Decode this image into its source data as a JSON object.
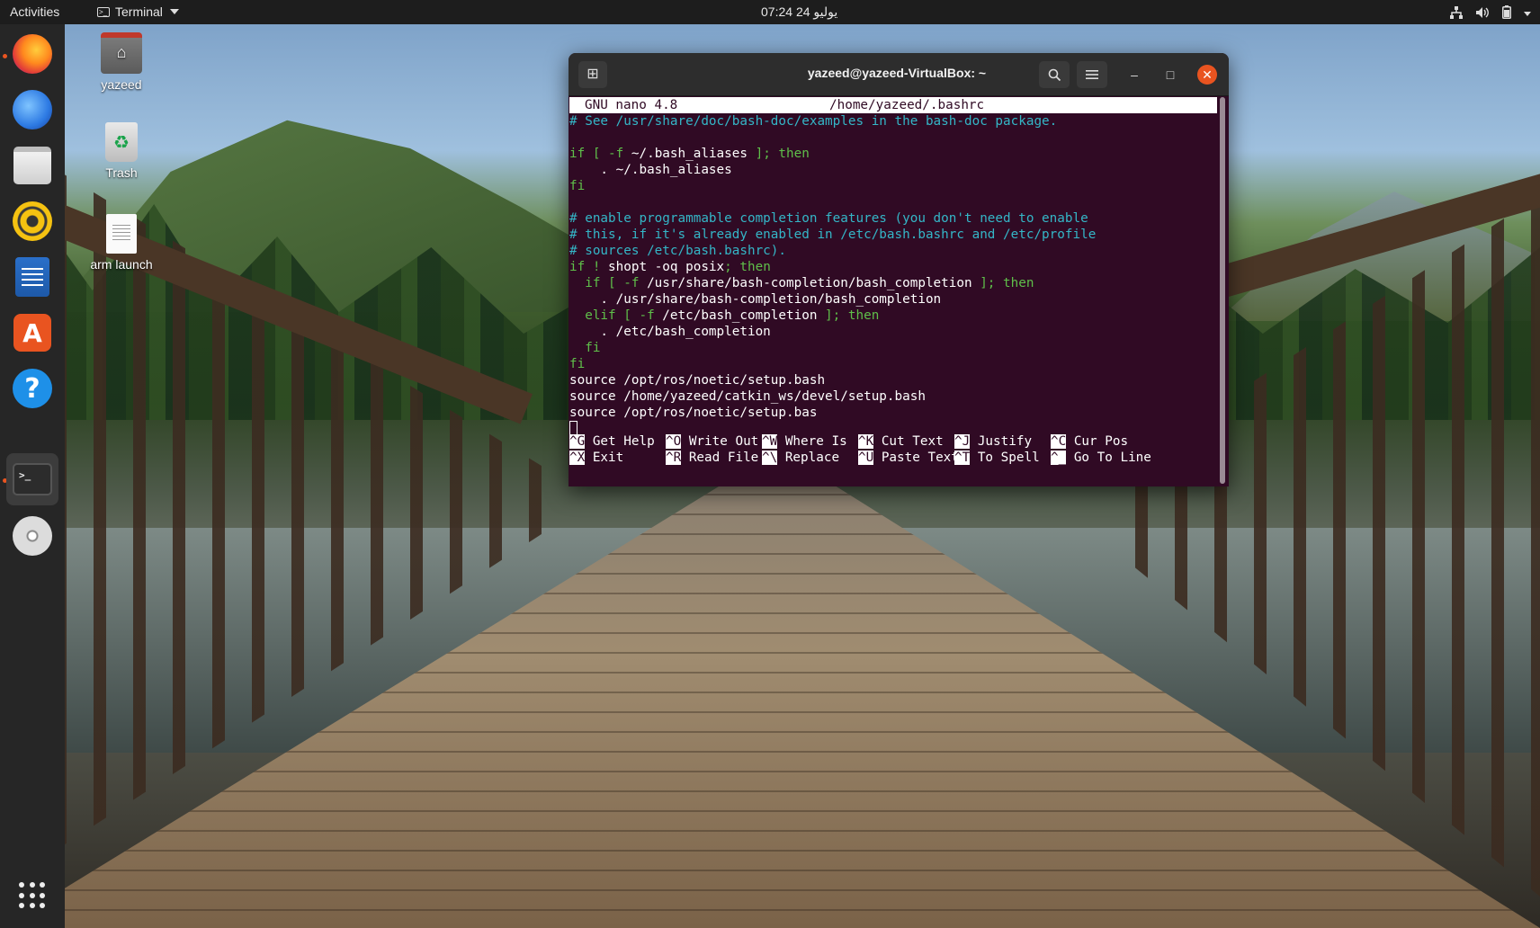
{
  "topbar": {
    "activities": "Activities",
    "app_menu_label": "Terminal",
    "clock": "يوليو 24  07:24",
    "icons": [
      "network-icon",
      "volume-icon",
      "battery-icon",
      "system-menu-caret"
    ]
  },
  "dock": {
    "items": [
      {
        "name": "firefox",
        "icon": "firefox-icon"
      },
      {
        "name": "thunderbird",
        "icon": "thunderbird-icon"
      },
      {
        "name": "files",
        "icon": "files-icon"
      },
      {
        "name": "rhythmbox",
        "icon": "rhythmbox-icon"
      },
      {
        "name": "libreoffice-writer",
        "icon": "writer-icon"
      },
      {
        "name": "ubuntu-software",
        "icon": "software-store-icon"
      },
      {
        "name": "help",
        "icon": "help-icon"
      },
      {
        "name": "terminal",
        "icon": "terminal-icon",
        "active": true
      },
      {
        "name": "dvd",
        "icon": "dvd-icon"
      },
      {
        "name": "show-applications",
        "icon": "app-grid-icon"
      }
    ],
    "terminal_glyph": ">_",
    "help_glyph": "?",
    "store_glyph": "A"
  },
  "desktop": {
    "icons": [
      {
        "label": "yazeed",
        "icon": "home-folder-icon"
      },
      {
        "label": "Trash",
        "icon": "trash-icon"
      },
      {
        "label": "arm launch",
        "icon": "text-file-icon"
      }
    ]
  },
  "terminal": {
    "title": "yazeed@yazeed-VirtualBox: ~",
    "new_tab_glyph": "⊞",
    "search_glyph": "⌕",
    "menu_glyph": "☰",
    "minimize_glyph": "–",
    "maximize_glyph": "□",
    "close_glyph": "✕",
    "nano": {
      "version": "GNU nano 4.8",
      "file": "/home/yazeed/.bashrc",
      "lines": [
        [
          {
            "t": "# See /usr/share/doc/bash-doc/examples in the bash-doc package.",
            "c": "comment"
          }
        ],
        [],
        [
          {
            "t": "if",
            "c": "kw"
          },
          {
            "t": " [ -f ",
            "c": "kw"
          },
          {
            "t": "~/.bash_aliases",
            "c": "plain"
          },
          {
            "t": " ]; then",
            "c": "kw"
          }
        ],
        [
          {
            "t": "    . ~/.bash_aliases",
            "c": "plain"
          }
        ],
        [
          {
            "t": "fi",
            "c": "kw"
          }
        ],
        [],
        [
          {
            "t": "# enable programmable completion features (you don't need to enable",
            "c": "comment"
          }
        ],
        [
          {
            "t": "# this, if it's already enabled in /etc/bash.bashrc and /etc/profile",
            "c": "comment"
          }
        ],
        [
          {
            "t": "# sources /etc/bash.bashrc).",
            "c": "comment"
          }
        ],
        [
          {
            "t": "if ! ",
            "c": "kw"
          },
          {
            "t": "shopt -oq posix",
            "c": "plain"
          },
          {
            "t": "; then",
            "c": "kw"
          }
        ],
        [
          {
            "t": "  if [ -f ",
            "c": "kw"
          },
          {
            "t": "/usr/share/bash-completion/bash_completion",
            "c": "plain"
          },
          {
            "t": " ]; then",
            "c": "kw"
          }
        ],
        [
          {
            "t": "    . /usr/share/bash-completion/bash_completion",
            "c": "plain"
          }
        ],
        [
          {
            "t": "  elif [ -f ",
            "c": "kw"
          },
          {
            "t": "/etc/bash_completion",
            "c": "plain"
          },
          {
            "t": " ]; then",
            "c": "kw"
          }
        ],
        [
          {
            "t": "    . /etc/bash_completion",
            "c": "plain"
          }
        ],
        [
          {
            "t": "  fi",
            "c": "kw"
          }
        ],
        [
          {
            "t": "fi",
            "c": "kw"
          }
        ],
        [
          {
            "t": "source /opt/ros/noetic/setup.bash",
            "c": "plain"
          }
        ],
        [
          {
            "t": "source /home/yazeed/catkin_ws/devel/setup.bash",
            "c": "plain"
          }
        ],
        [
          {
            "t": "source /opt/ros/noetic/setup.bas",
            "c": "plain"
          }
        ],
        [
          {
            "cursor": true
          }
        ]
      ],
      "shortcuts_row1": [
        {
          "key": "^G",
          "label": " Get Help"
        },
        {
          "key": "^O",
          "label": " Write Out"
        },
        {
          "key": "^W",
          "label": " Where Is"
        },
        {
          "key": "^K",
          "label": " Cut Text"
        },
        {
          "key": "^J",
          "label": " Justify"
        },
        {
          "key": "^C",
          "label": " Cur Pos"
        }
      ],
      "shortcuts_row2": [
        {
          "key": "^X",
          "label": " Exit"
        },
        {
          "key": "^R",
          "label": " Read File"
        },
        {
          "key": "^\\",
          "label": " Replace"
        },
        {
          "key": "^U",
          "label": " Paste Text"
        },
        {
          "key": "^T",
          "label": " To Spell"
        },
        {
          "key": "^_",
          "label": " Go To Line"
        }
      ]
    }
  },
  "colors": {
    "terminal_bg": "#300a24",
    "comment": "#34b6c7",
    "keyword": "#5fbf4a",
    "accent": "#e95420"
  }
}
